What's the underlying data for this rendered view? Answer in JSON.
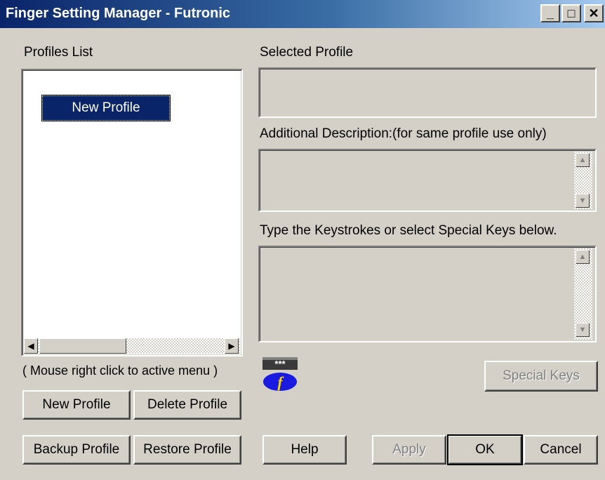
{
  "window": {
    "title": "Finger Setting Manager - Futronic",
    "minimize_glyph": "_",
    "maximize_glyph": "□",
    "close_glyph": "✕"
  },
  "profiles": {
    "heading": "Profiles List",
    "items": [
      "New Profile"
    ],
    "hint": "( Mouse right click to active menu )"
  },
  "selected": {
    "heading": "Selected Profile",
    "value": ""
  },
  "description": {
    "heading": "Additional Description:(for same profile use only)",
    "value": ""
  },
  "keystrokes": {
    "heading": "Type the Keystrokes or select Special Keys below.",
    "value": ""
  },
  "logo": {
    "badge_text": "***",
    "letter": "f"
  },
  "buttons": {
    "special_keys": "Special Keys",
    "new_profile": "New Profile",
    "delete_profile": "Delete Profile",
    "backup_profile": "Backup Profile",
    "restore_profile": "Restore Profile",
    "help": "Help",
    "apply": "Apply",
    "ok": "OK",
    "cancel": "Cancel"
  },
  "colors": {
    "title_bar": "#0a246a",
    "selection": "#0a246a",
    "face": "#d4d0c8"
  }
}
